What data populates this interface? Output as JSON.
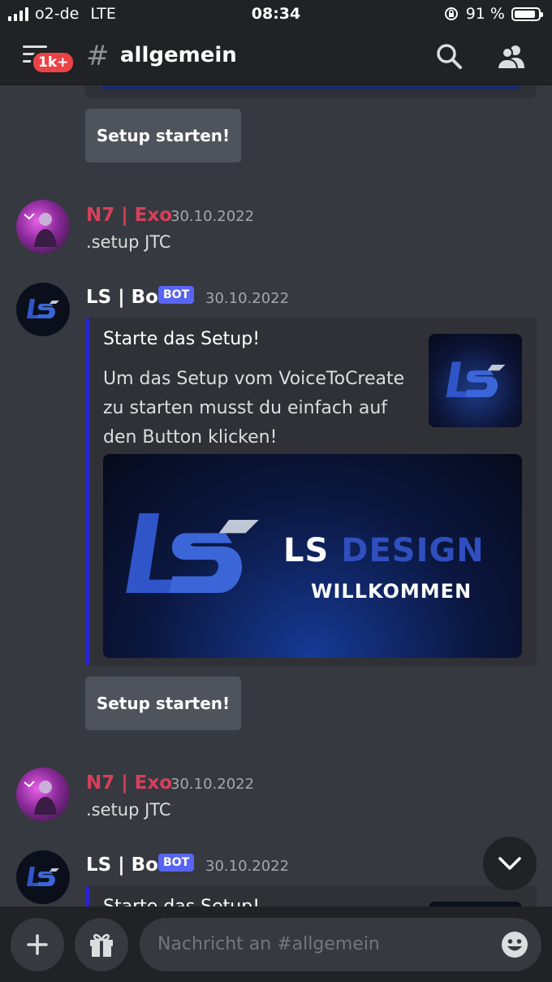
{
  "status_bar": {
    "carrier": "o2-de",
    "network": "LTE",
    "time": "08:34",
    "battery_percent": "91 %",
    "battery_level": 0.91
  },
  "header": {
    "badge": "1k+",
    "hash_symbol": "#",
    "channel": "allgemein",
    "icons": [
      "menu-icon",
      "search-icon",
      "members-icon"
    ]
  },
  "messages": [
    {
      "type": "button",
      "label": "Setup starten!"
    },
    {
      "type": "user",
      "author": "N7 | Exo",
      "timestamp": "30.10.2022",
      "text": ".setup JTC"
    },
    {
      "type": "bot",
      "author": "LS | Bot",
      "tag": "BOT",
      "timestamp": "30.10.2022",
      "embed": {
        "title": "Starte das Setup!",
        "description": "Um das Setup vom VoiceToCreate zu starten musst du einfach auf den Button klicken!",
        "image_title_white": "LS",
        "image_title_blue": "DESIGN",
        "image_subtitle": "WILLKOMMEN"
      },
      "button_label": "Setup starten!"
    },
    {
      "type": "user",
      "author": "N7 | Exo",
      "timestamp": "30.10.2022",
      "text": ".setup JTC"
    },
    {
      "type": "bot",
      "author": "LS | Bot",
      "tag": "BOT",
      "timestamp": "30.10.2022",
      "embed_title_partial": "Starte das Setup!"
    }
  ],
  "composer": {
    "placeholder": "Nachricht an #allgemein",
    "icons": [
      "plus-icon",
      "gift-icon",
      "emoji-icon"
    ]
  },
  "colors": {
    "background": "#36393f",
    "bars": "#202225",
    "accent": "#5865f2",
    "embed_border": "#2b24d4",
    "exo_name": "#d6405a"
  }
}
